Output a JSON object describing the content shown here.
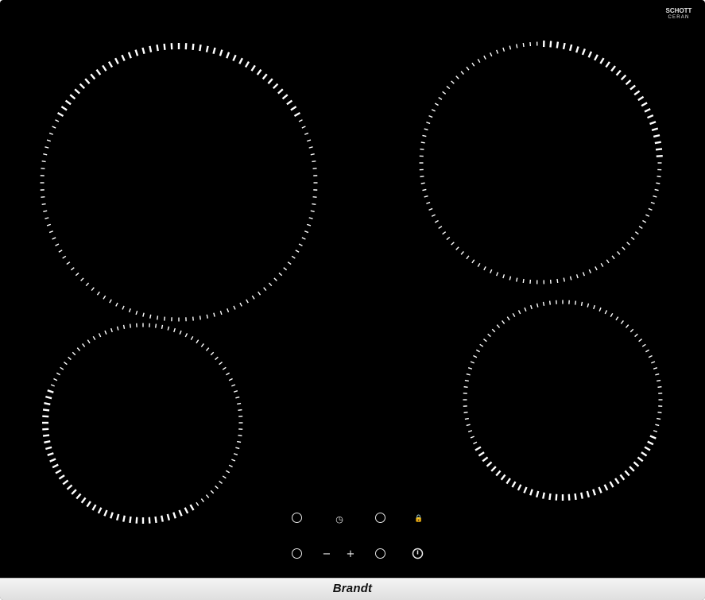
{
  "brand": {
    "name": "Brandt",
    "glass_logo_line1": "SCHOTT",
    "glass_logo_line2": "CERAN"
  },
  "colors": {
    "glass": "#000000",
    "markings": "#ffffff",
    "trim": "#e6e6e6"
  },
  "zones": [
    {
      "name": "rear-left"
    },
    {
      "name": "rear-right"
    },
    {
      "name": "front-left"
    },
    {
      "name": "front-right"
    }
  ],
  "controls": {
    "timer_symbol": "◷",
    "lock_symbol": "🔒",
    "minus_label": "−",
    "plus_label": "+",
    "power_symbol": "⏻"
  },
  "icons": {
    "timer": "timer-icon",
    "lock": "lock-icon",
    "power": "power-icon",
    "zone_select": "zone-select-icon"
  }
}
